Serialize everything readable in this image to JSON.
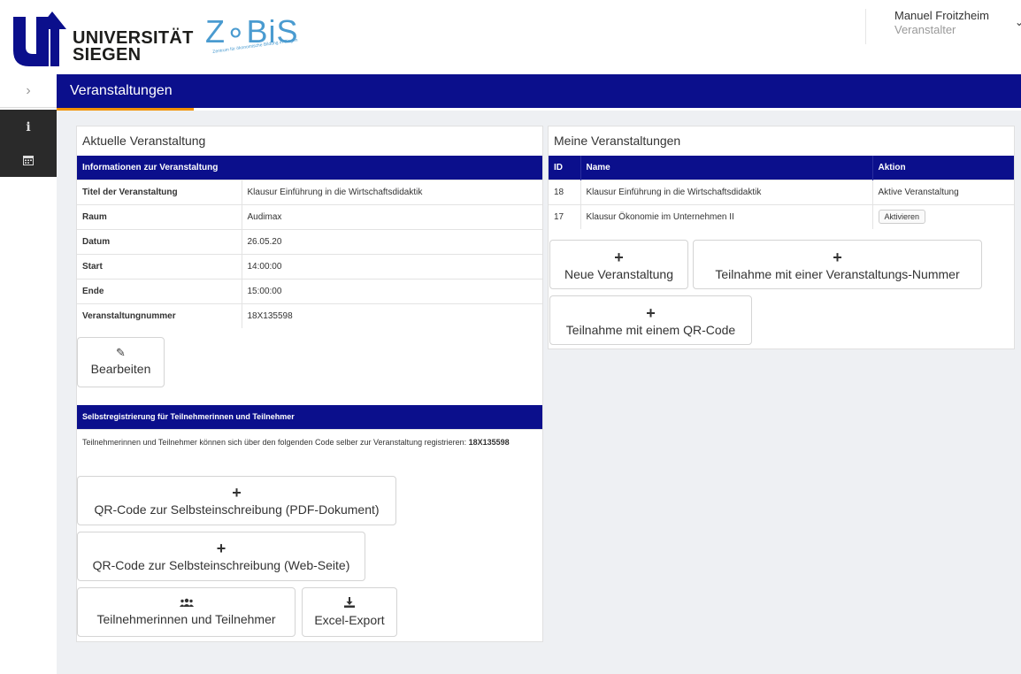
{
  "header": {
    "university": "UNIVERSITÄT SIEGEN",
    "university_line1": "UNIVERSITÄT",
    "university_line2": "SIEGEN",
    "brand": "Z∘BiS",
    "brand_sub": "Zentrum für ökonomische Bildung in Siegen",
    "user_name": "Manuel Froitzheim",
    "user_role": "Veranstalter"
  },
  "nav": {
    "toggle_icon": "chevron-right-icon",
    "title": "Veranstaltungen",
    "sidebar": [
      {
        "icon": "info-icon",
        "glyph": "i"
      },
      {
        "icon": "calendar-icon",
        "glyph": "▦"
      }
    ]
  },
  "current_event": {
    "panel_title": "Aktuelle Veranstaltung",
    "table_header": "Informationen zur Veranstaltung",
    "rows": [
      {
        "key": "Titel der Veranstaltung",
        "value": "Klausur Einführung in die Wirtschaftsdidaktik"
      },
      {
        "key": "Raum",
        "value": "Audimax"
      },
      {
        "key": "Datum",
        "value": "26.05.20"
      },
      {
        "key": "Start",
        "value": "14:00:00"
      },
      {
        "key": "Ende",
        "value": "15:00:00"
      },
      {
        "key": "Veranstaltungnummer",
        "value": "18X135598"
      }
    ],
    "edit_button": "Bearbeiten",
    "self_reg_header": "Selbstregistrierung für Teilnehmerinnen und Teilnehmer",
    "self_reg_text": "Teilnehmerinnen und Teilnehmer können sich über den folgenden Code selber zur Veranstaltung registrieren:",
    "self_reg_code": "18X135598",
    "qr_pdf_button": "QR-Code zur Selbsteinschreibung (PDF-Dokument)",
    "qr_web_button": "QR-Code zur Selbsteinschreibung (Web-Seite)",
    "participants_button": "Teilnehmerinnen und Teilnehmer",
    "excel_button": "Excel-Export"
  },
  "my_events": {
    "panel_title": "Meine Veranstaltungen",
    "columns": [
      "ID",
      "Name",
      "Aktion"
    ],
    "rows": [
      {
        "id": "18",
        "name": "Klausur Einführung in die Wirtschaftsdidaktik",
        "action": "Aktive Veranstaltung"
      },
      {
        "id": "17",
        "name": "Klausur Ökonomie im Unternehmen II",
        "action": "Aktivieren"
      }
    ],
    "new_event_button": "Neue Veranstaltung",
    "join_number_button": "Teilnahme mit einer Veranstaltungs-Nummer",
    "join_qr_button": "Teilnahme mit einem QR-Code"
  },
  "colors": {
    "primary": "#0b0f8c",
    "accent": "#f39200",
    "brand_blue": "#4a9bd0"
  }
}
